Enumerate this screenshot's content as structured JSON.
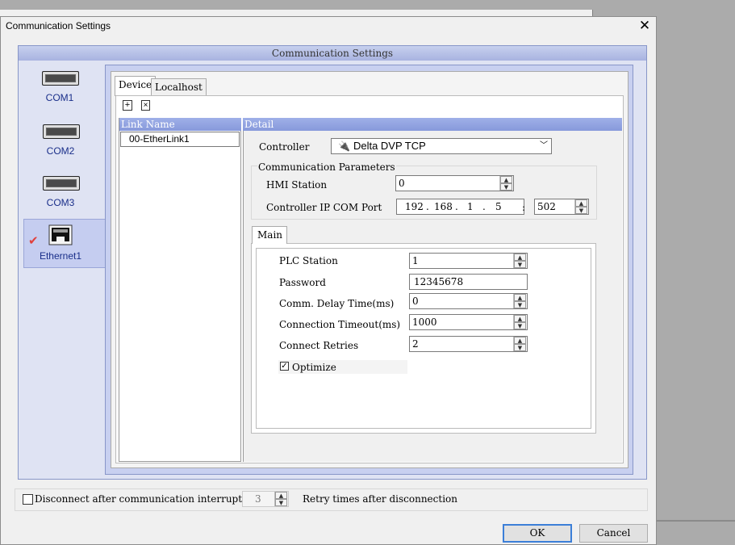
{
  "window": {
    "title": "Communication Settings",
    "close_symbol": "✕"
  },
  "frame": {
    "title": "Communication Settings"
  },
  "devices": [
    {
      "label": "COM1",
      "icon": "serial-port-icon"
    },
    {
      "label": "COM2",
      "icon": "serial-port-icon"
    },
    {
      "label": "COM3",
      "icon": "serial-port-icon"
    },
    {
      "label": "Ethernet1",
      "icon": "ethernet-port-icon",
      "selected": true,
      "check": "✔"
    }
  ],
  "tabs": {
    "device": "Device",
    "localhost": "Localhost"
  },
  "toolbar": {
    "add": "+",
    "delete": "×"
  },
  "link_list": {
    "header": "Link Name",
    "items": [
      {
        "prefix": "00",
        "name": "-EtherLink1"
      }
    ]
  },
  "detail": {
    "header": "Detail",
    "controller_label": "Controller",
    "controller_value": "Delta DVP TCP",
    "comm_params_title": "Communication Parameters",
    "hmi_station_label": "HMI Station",
    "hmi_station_value": "0",
    "controller_ip_label": "Controller IP",
    "com_port_label": ": COM Port",
    "ip": [
      "192",
      "168",
      "1",
      "5"
    ],
    "ip_sep": ".",
    "port_sep": ":",
    "port": "502"
  },
  "main_tab": {
    "label": "Main",
    "plc_station_label": "PLC Station",
    "plc_station_value": "1",
    "password_label": "Password",
    "password_value": "12345678",
    "comm_delay_label": "Comm. Delay Time(ms)",
    "comm_delay_value": "0",
    "conn_timeout_label": "Connection Timeout(ms)",
    "conn_timeout_value": "1000",
    "retries_label": "Connect Retries",
    "retries_value": "2",
    "optimize_label": "Optimize",
    "optimize_checked": "✓"
  },
  "footer": {
    "disconnect_label": "Disconnect after communication interrupt",
    "retry_value": "3",
    "retry_label": "Retry times after disconnection",
    "ok": "OK",
    "cancel": "Cancel"
  },
  "colors": {
    "accent": "#8799db",
    "device_text": "#1a2f8a",
    "selected_bg": "#c5cdf0",
    "check_red": "#e0403c"
  }
}
